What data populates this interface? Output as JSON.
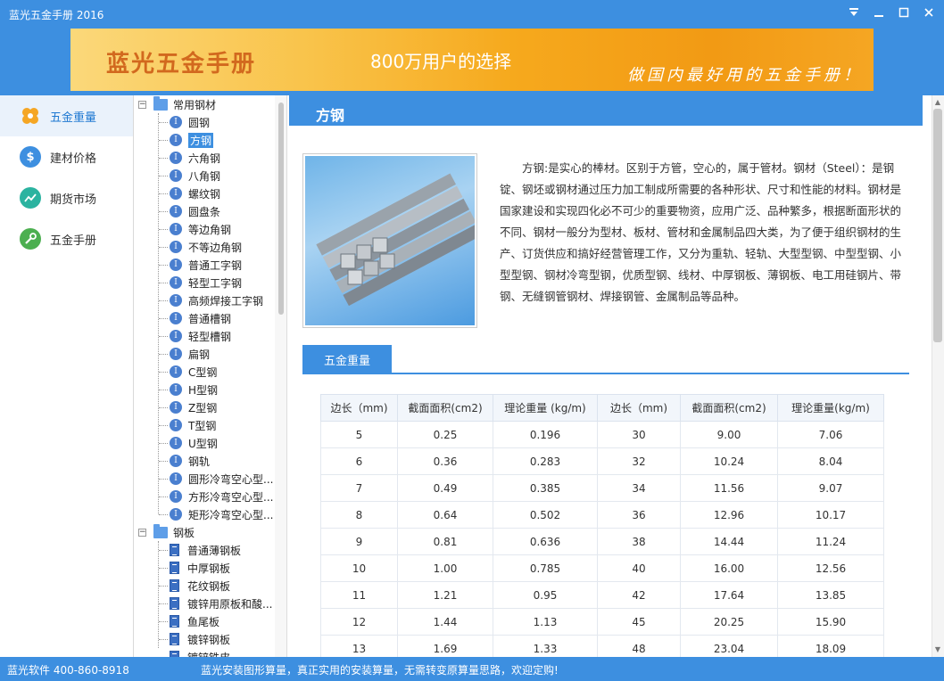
{
  "window": {
    "title": "蓝光五金手册 2016"
  },
  "banner": {
    "brand": "蓝光五金手册",
    "slogan": "800万用户的选择",
    "tagline": "做国内最好用的五金手册！"
  },
  "nav": {
    "items": [
      {
        "label": "五金重量",
        "icon": "hex-cluster-icon",
        "color": "#f5a623",
        "active": true
      },
      {
        "label": "建材价格",
        "icon": "dollar-icon",
        "color": "#3d8fe0"
      },
      {
        "label": "期货市场",
        "icon": "trend-chart-icon",
        "color": "#2bb3a0"
      },
      {
        "label": "五金手册",
        "icon": "wrench-icon",
        "color": "#4caf50"
      }
    ]
  },
  "tree": {
    "group1": {
      "label": "常用钢材",
      "items": [
        "圆钢",
        "方钢",
        "六角钢",
        "八角钢",
        "螺纹钢",
        "圆盘条",
        "等边角钢",
        "不等边角钢",
        "普通工字钢",
        "轻型工字钢",
        "高频焊接工字钢",
        "普通槽钢",
        "轻型槽钢",
        "扁钢",
        "C型钢",
        "H型钢",
        "Z型钢",
        "T型钢",
        "U型钢",
        "钢轨",
        "圆形冷弯空心型...",
        "方形冷弯空心型...",
        "矩形冷弯空心型..."
      ],
      "selected": "方钢"
    },
    "group2": {
      "label": "钢板",
      "items": [
        "普通薄钢板",
        "中厚钢板",
        "花纹钢板",
        "镀锌用原板和酸...",
        "鱼尾板",
        "镀锌钢板",
        "镀锌铁皮"
      ]
    }
  },
  "main": {
    "title": "方钢",
    "description": "方钢:是实心的棒材。区别于方管，空心的，属于管材。钢材（Steel）：是钢锭、钢坯或钢材通过压力加工制成所需要的各种形状、尺寸和性能的材料。钢材是国家建设和实现四化必不可少的重要物资，应用广泛、品种繁多，根据断面形状的不同、钢材一般分为型材、板材、管材和金属制品四大类，为了便于组织钢材的生产、订货供应和搞好经营管理工作，又分为重轨、轻轨、大型型钢、中型型钢、小型型钢、钢材冷弯型钢，优质型钢、线材、中厚钢板、薄钢板、电工用硅钢片、带钢、无缝钢管钢材、焊接钢管、金属制品等品种。",
    "section_tab": "五金重量",
    "table": {
      "headers": [
        "边长（mm)",
        "截面面积(cm2)",
        "理论重量 (kg/m)",
        "边长（mm)",
        "截面面积(cm2)",
        "理论重量(kg/m)"
      ],
      "rows": [
        [
          "5",
          "0.25",
          "0.196",
          "30",
          "9.00",
          "7.06"
        ],
        [
          "6",
          "0.36",
          "0.283",
          "32",
          "10.24",
          "8.04"
        ],
        [
          "7",
          "0.49",
          "0.385",
          "34",
          "11.56",
          "9.07"
        ],
        [
          "8",
          "0.64",
          "0.502",
          "36",
          "12.96",
          "10.17"
        ],
        [
          "9",
          "0.81",
          "0.636",
          "38",
          "14.44",
          "11.24"
        ],
        [
          "10",
          "1.00",
          "0.785",
          "40",
          "16.00",
          "12.56"
        ],
        [
          "11",
          "1.21",
          "0.95",
          "42",
          "17.64",
          "13.85"
        ],
        [
          "12",
          "1.44",
          "1.13",
          "45",
          "20.25",
          "15.90"
        ],
        [
          "13",
          "1.69",
          "1.33",
          "48",
          "23.04",
          "18.09"
        ]
      ]
    }
  },
  "status": {
    "left": "蓝光软件 400-860-8918",
    "message": "蓝光安装图形算量，真正实用的安装算量，无需转变原算量思路，欢迎定购!"
  },
  "colors": {
    "accent": "#3d8fe0"
  }
}
